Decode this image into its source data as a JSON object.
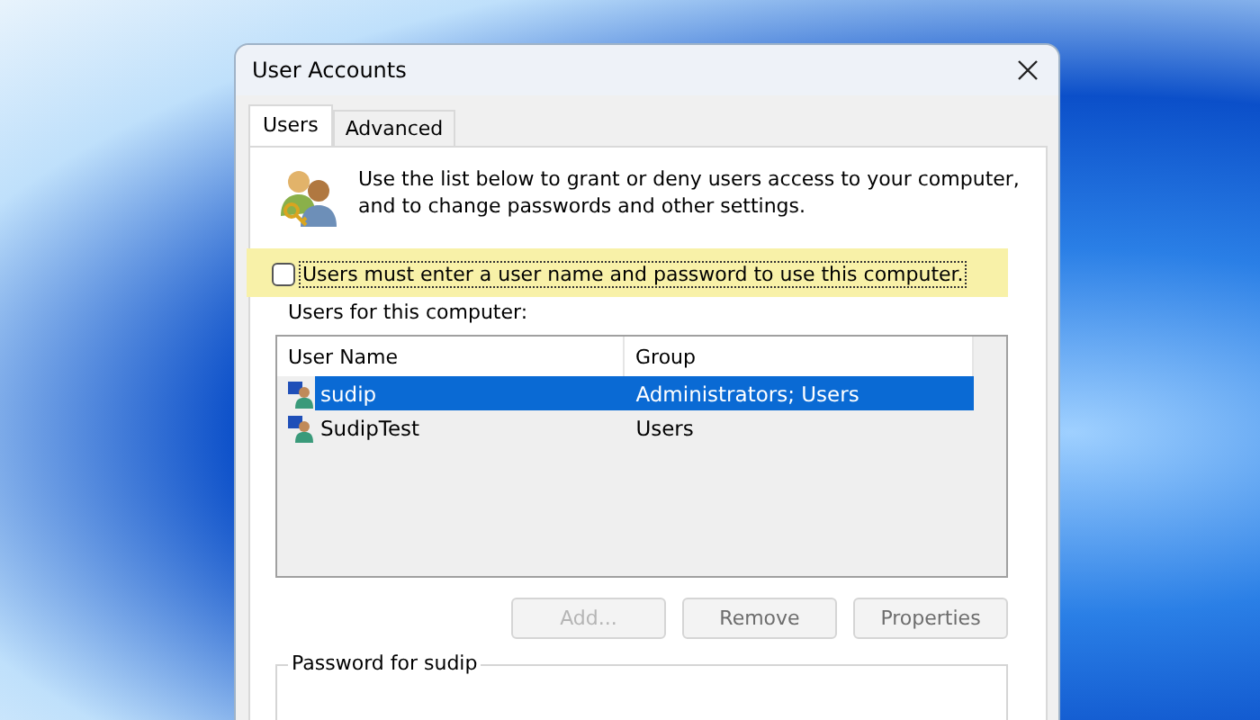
{
  "window": {
    "title": "User Accounts"
  },
  "tabs": [
    {
      "label": "Users",
      "selected": true
    },
    {
      "label": "Advanced",
      "selected": false
    }
  ],
  "intro": "Use the list below to grant or deny users access to your computer, and to change passwords and other settings.",
  "require_password": {
    "label": "Users must enter a user name and password to use this computer.",
    "checked": false,
    "highlighted": true
  },
  "users_label": "Users for this computer:",
  "table": {
    "columns": [
      "User Name",
      "Group"
    ],
    "rows": [
      {
        "name": "sudip",
        "group": "Administrators; Users",
        "selected": true
      },
      {
        "name": "SudipTest",
        "group": "Users",
        "selected": false
      }
    ]
  },
  "buttons": [
    {
      "label": "Add...",
      "disabled": true
    },
    {
      "label": "Remove",
      "disabled": false
    },
    {
      "label": "Properties",
      "disabled": false
    }
  ],
  "password_group": {
    "title": "Password for sudip"
  }
}
